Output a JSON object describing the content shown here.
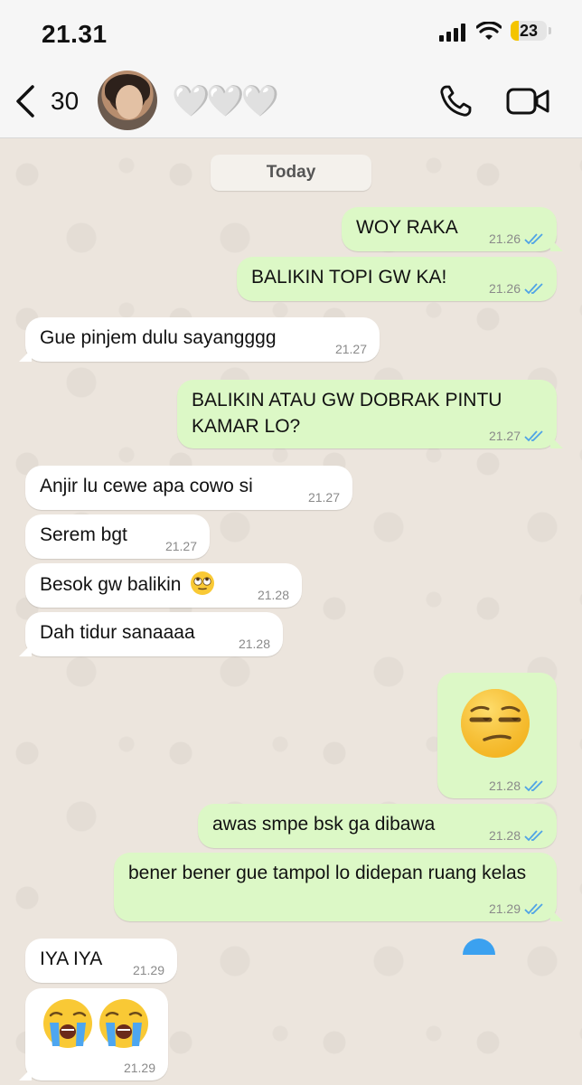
{
  "status_bar": {
    "time": "21.31",
    "battery": "23",
    "battery_level": 0.23
  },
  "header": {
    "back_count": "30",
    "contact_name": "🤍🤍🤍"
  },
  "chat": {
    "date_label": "Today",
    "messages": [
      {
        "dir": "out",
        "text": "WOY RAKA",
        "time": "21.26",
        "read": true
      },
      {
        "dir": "out",
        "text": "BALIKIN TOPI GW KA!",
        "time": "21.26",
        "read": true
      },
      {
        "dir": "in",
        "text": "Gue pinjem dulu sayangggg",
        "time": "21.27"
      },
      {
        "dir": "out",
        "text": "BALIKIN ATAU GW DOBRAK PINTU KAMAR LO?",
        "time": "21.27",
        "read": true
      },
      {
        "dir": "in",
        "text": "Anjir lu cewe apa cowo si",
        "time": "21.27"
      },
      {
        "dir": "in",
        "text": "Serem bgt",
        "time": "21.27"
      },
      {
        "dir": "in",
        "text": "Besok gw balikin",
        "emoji": "face-with-rolling-eyes",
        "time": "21.28"
      },
      {
        "dir": "in",
        "text": "Dah tidur sanaaaa",
        "time": "21.28"
      },
      {
        "dir": "out",
        "emoji": "unamused-face",
        "time": "21.28",
        "read": true
      },
      {
        "dir": "out",
        "text": "awas smpe bsk ga dibawa",
        "time": "21.28",
        "read": true
      },
      {
        "dir": "out",
        "text": "bener bener gue tampol lo didepan ruang kelas",
        "time": "21.29",
        "read": true
      },
      {
        "dir": "in",
        "text": "IYA IYA",
        "time": "21.29"
      },
      {
        "dir": "in",
        "emoji": "loudly-crying-face x2",
        "time": "21.29"
      }
    ]
  },
  "colors": {
    "outgoing": "#dcf8c6",
    "incoming": "#ffffff",
    "read_ticks": "#4fa3e6",
    "wallpaper": "#ece5dd"
  }
}
